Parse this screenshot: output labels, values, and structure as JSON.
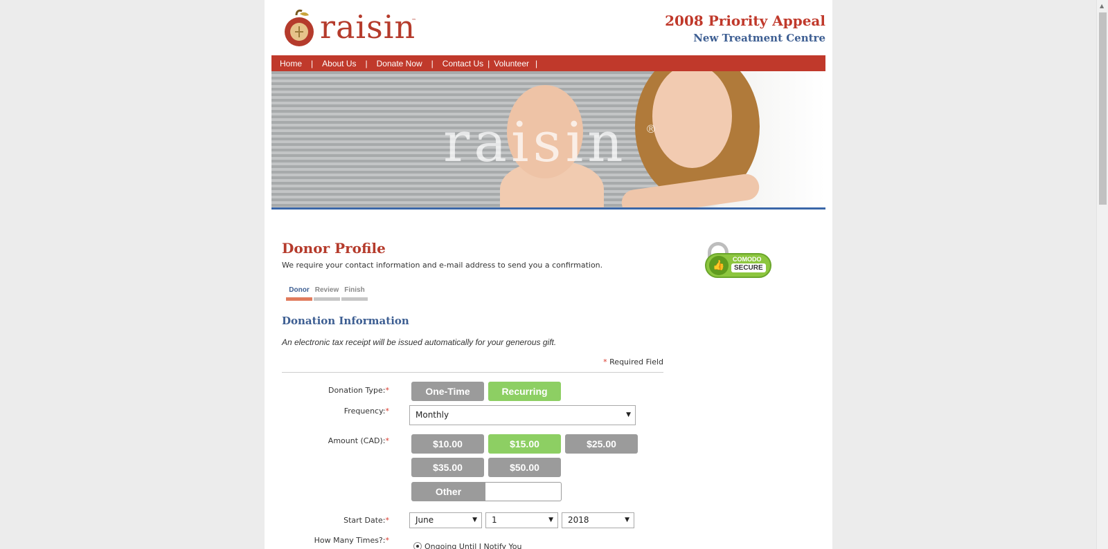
{
  "header": {
    "logo_text": "raisin",
    "logo_tm": "™",
    "appeal_title": "2008 Priority Appeal",
    "appeal_subtitle": "New Treatment Centre"
  },
  "nav": {
    "items": [
      "Home",
      "About Us",
      "Donate Now",
      "Contact Us",
      "Volunteer"
    ],
    "separator": "|"
  },
  "banner": {
    "watermark": "raisin",
    "registered": "®"
  },
  "profile": {
    "title": "Donor Profile",
    "description": "We require your contact information and e-mail address to send you a confirmation."
  },
  "secure_badge": {
    "line1": "COMODO",
    "line2": "SECURE"
  },
  "steps": [
    {
      "label": "Donor",
      "active": true
    },
    {
      "label": "Review",
      "active": false
    },
    {
      "label": "Finish",
      "active": false
    }
  ],
  "donation": {
    "title": "Donation Information",
    "tax_note": "An electronic tax receipt will be issued automatically for your generous gift.",
    "required_star": "*",
    "required_text": "Required Field",
    "type_label": "Donation Type:",
    "type_options": [
      "One-Time",
      "Recurring"
    ],
    "type_selected": "Recurring",
    "frequency_label": "Frequency:",
    "frequency_value": "Monthly",
    "amount_label": "Amount (CAD):",
    "amounts": [
      "$10.00",
      "$15.00",
      "$25.00",
      "$35.00",
      "$50.00"
    ],
    "amount_selected": "$15.00",
    "other_label": "Other",
    "other_value": "",
    "start_label": "Start Date:",
    "start_month": "June",
    "start_day": "1",
    "start_year": "2018",
    "times_label": "How Many Times?:",
    "times_option": "Ongoing Until I Notify You"
  },
  "colors": {
    "brand_red": "#c0392b",
    "brand_blue": "#3d5e92",
    "button_gray": "#9b9b9b",
    "button_selected": "#8dcf63"
  }
}
